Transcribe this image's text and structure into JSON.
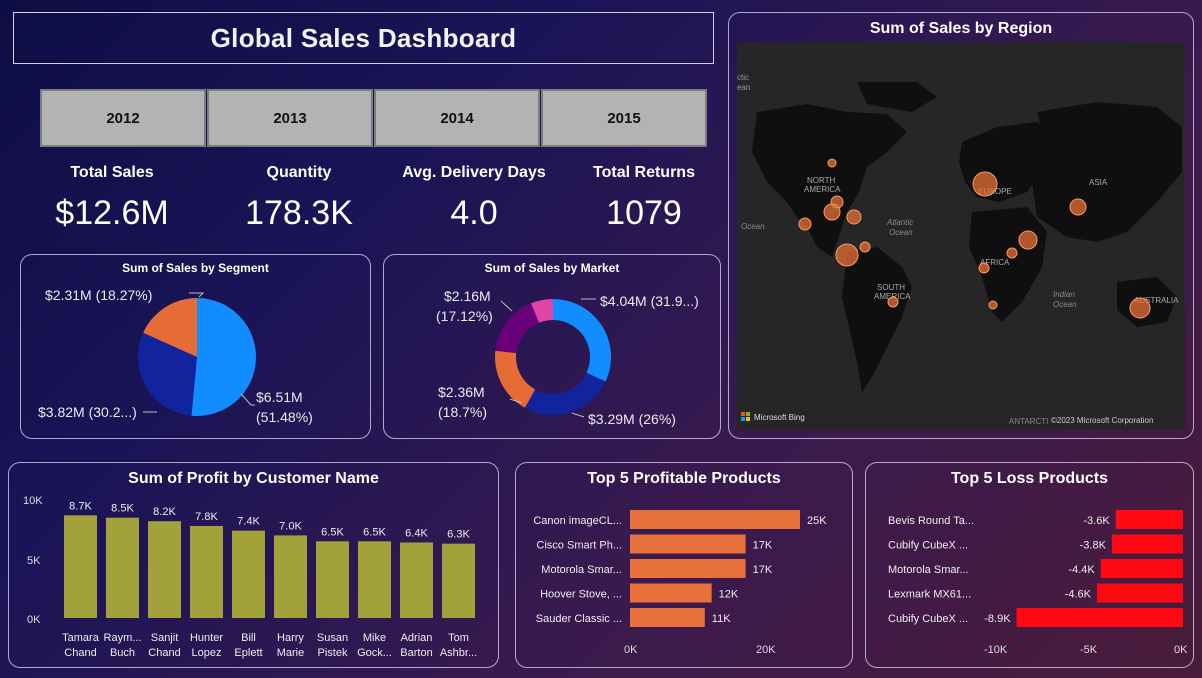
{
  "header": {
    "title": "Global Sales Dashboard"
  },
  "years": [
    "2012",
    "2013",
    "2014",
    "2015"
  ],
  "kpis": [
    {
      "label": "Total Sales",
      "value": "$12.6M"
    },
    {
      "label": "Quantity",
      "value": "178.3K"
    },
    {
      "label": "Avg. Delivery Days",
      "value": "4.0"
    },
    {
      "label": "Total Returns",
      "value": "1079"
    }
  ],
  "segment_pie": {
    "title": "Sum of Sales by Segment",
    "labels": [
      "$6.51M",
      "(51.48%)",
      "$3.82M (30.2...)",
      "$2.31M (18.27%)"
    ]
  },
  "market_donut": {
    "title": "Sum of Sales by Market",
    "labels": [
      "$4.04M (31.9...)",
      "$3.29M (26%)",
      "$2.36M",
      "(18.7%)",
      "$2.16M",
      "(17.12%)"
    ]
  },
  "map": {
    "title": "Sum of Sales by Region",
    "labels": {
      "north_america_1": "NORTH",
      "north_america_2": "AMERICA",
      "europe": "EUROPE",
      "asia": "ASIA",
      "atlantic_1": "Atlantic",
      "atlantic_2": "Ocean",
      "ocean_left": "Ocean",
      "arctic_1": "ctic",
      "arctic_2": "ean",
      "africa": "AFRICA",
      "south_america_1": "SOUTH",
      "south_america_2": "AMERICA",
      "indian_1": "Indian",
      "indian_2": "Ocean",
      "australia": "AUSTRALIA",
      "antarctica": "ANTARCTI",
      "copyright": "©2023 Microsoft Corporation",
      "bing": "Microsoft Bing"
    }
  },
  "profit_customers": {
    "title": "Sum of Profit by Customer Name",
    "y_ticks": [
      "10K",
      "5K",
      "0K"
    ]
  },
  "top_profitable": {
    "title": "Top 5 Profitable Products",
    "x_ticks": [
      "0K",
      "20K"
    ]
  },
  "top_loss": {
    "title": "Top 5 Loss Products",
    "x_ticks": [
      "-10K",
      "-5K",
      "0K"
    ]
  },
  "colors": {
    "bar_olive": "#a3a13a",
    "bar_orange": "#e8703a",
    "bar_red": "#ff0a14",
    "pie_blue": "#118dff",
    "pie_navy": "#12239e",
    "pie_orange": "#e66c37",
    "pie_purple": "#6b007b",
    "pie_pink": "#e044a7",
    "map_bubble": "#e8703a"
  },
  "chart_data": [
    {
      "type": "pie",
      "title": "Sum of Sales by Segment",
      "slices": [
        {
          "value": 6.51,
          "percent": 51.48
        },
        {
          "value": 3.82,
          "percent": 30.25
        },
        {
          "value": 2.31,
          "percent": 18.27
        }
      ],
      "unit": "$M"
    },
    {
      "type": "pie",
      "title": "Sum of Sales by Market",
      "donut": true,
      "slices": [
        {
          "value": 4.04,
          "percent": 31.9
        },
        {
          "value": 3.29,
          "percent": 26.0
        },
        {
          "value": 2.36,
          "percent": 18.7
        },
        {
          "value": 2.16,
          "percent": 17.12
        },
        {
          "value": 0.78,
          "percent": 6.28
        }
      ],
      "unit": "$M"
    },
    {
      "type": "bar",
      "title": "Sum of Profit by Customer Name",
      "categories": [
        "Tamara Chand",
        "Raym... Buch",
        "Sanjit Chand",
        "Hunter Lopez",
        "Bill Eplett",
        "Harry Marie",
        "Susan Pistek",
        "Mike Gock...",
        "Adrian Barton",
        "Tom Ashbr..."
      ],
      "values": [
        8.7,
        8.5,
        8.2,
        7.8,
        7.4,
        7.0,
        6.5,
        6.5,
        6.4,
        6.3
      ],
      "value_labels": [
        "8.7K",
        "8.5K",
        "8.2K",
        "7.8K",
        "7.4K",
        "7.0K",
        "6.5K",
        "6.5K",
        "6.4K",
        "6.3K"
      ],
      "ylim": [
        0,
        10
      ],
      "unit": "K"
    },
    {
      "type": "bar",
      "orientation": "horizontal",
      "title": "Top 5 Profitable Products",
      "categories": [
        "Canon imageCL...",
        "Cisco Smart Ph...",
        "Motorola Smar...",
        "Hoover Stove, ...",
        "Sauder Classic ..."
      ],
      "values": [
        25,
        17,
        17,
        12,
        11
      ],
      "value_labels": [
        "25K",
        "17K",
        "17K",
        "12K",
        "11K"
      ],
      "xlim": [
        0,
        20
      ],
      "unit": "K"
    },
    {
      "type": "bar",
      "orientation": "horizontal",
      "title": "Top 5 Loss Products",
      "categories": [
        "Bevis Round Ta...",
        "Cubify CubeX ...",
        "Motorola Smar...",
        "Lexmark MX61...",
        "Cubify CubeX ..."
      ],
      "values": [
        -3.6,
        -3.8,
        -4.4,
        -4.6,
        -8.9
      ],
      "value_labels": [
        "-3.6K",
        "-3.8K",
        "-4.4K",
        "-4.6K",
        "-8.9K"
      ],
      "xlim": [
        -10,
        0
      ],
      "unit": "K"
    }
  ]
}
